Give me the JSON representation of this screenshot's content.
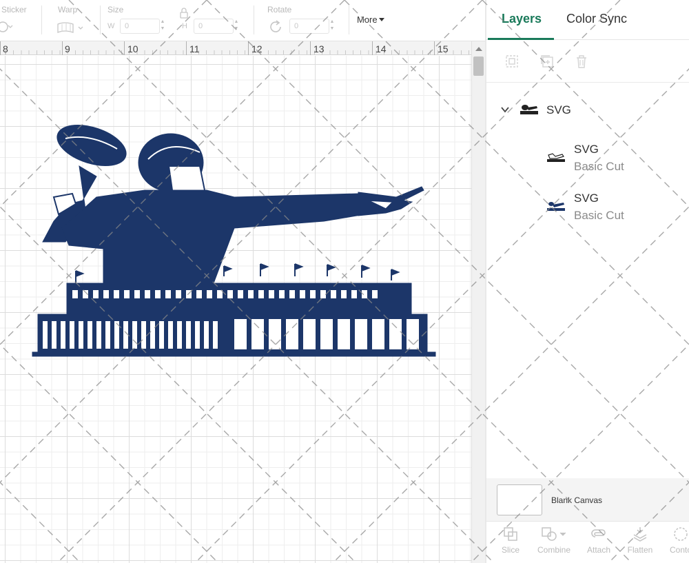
{
  "toolbar": {
    "sticker_label": "Sticker",
    "warp_label": "Warp",
    "size_label": "Size",
    "size_w_label": "W",
    "size_w_value": "0",
    "size_h_label": "H",
    "size_h_value": "0",
    "rotate_label": "Rotate",
    "rotate_value": "0",
    "more_label": "More"
  },
  "ruler": {
    "numbers": [
      "8",
      "9",
      "10",
      "11",
      "12",
      "13",
      "14",
      "15"
    ]
  },
  "panel": {
    "tabs": [
      {
        "label": "Layers",
        "active": true
      },
      {
        "label": "Color Sync",
        "active": false
      }
    ],
    "layers": {
      "group": {
        "name": "SVG",
        "expanded": true
      },
      "children": [
        {
          "name": "SVG",
          "operation": "Basic Cut"
        },
        {
          "name": "SVG",
          "operation": "Basic Cut"
        }
      ]
    },
    "blank_canvas_label": "Blank Canvas",
    "bottom_tools": [
      {
        "label": "Slice",
        "icon": "slice-icon"
      },
      {
        "label": "Combine",
        "icon": "combine-icon"
      },
      {
        "label": "Attach",
        "icon": "attach-icon"
      },
      {
        "label": "Flatten",
        "icon": "flatten-icon"
      },
      {
        "label": "Conto",
        "icon": "contour-icon"
      }
    ]
  },
  "colors": {
    "accent": "#1a7a5a",
    "design_fill": "#1c3669"
  }
}
